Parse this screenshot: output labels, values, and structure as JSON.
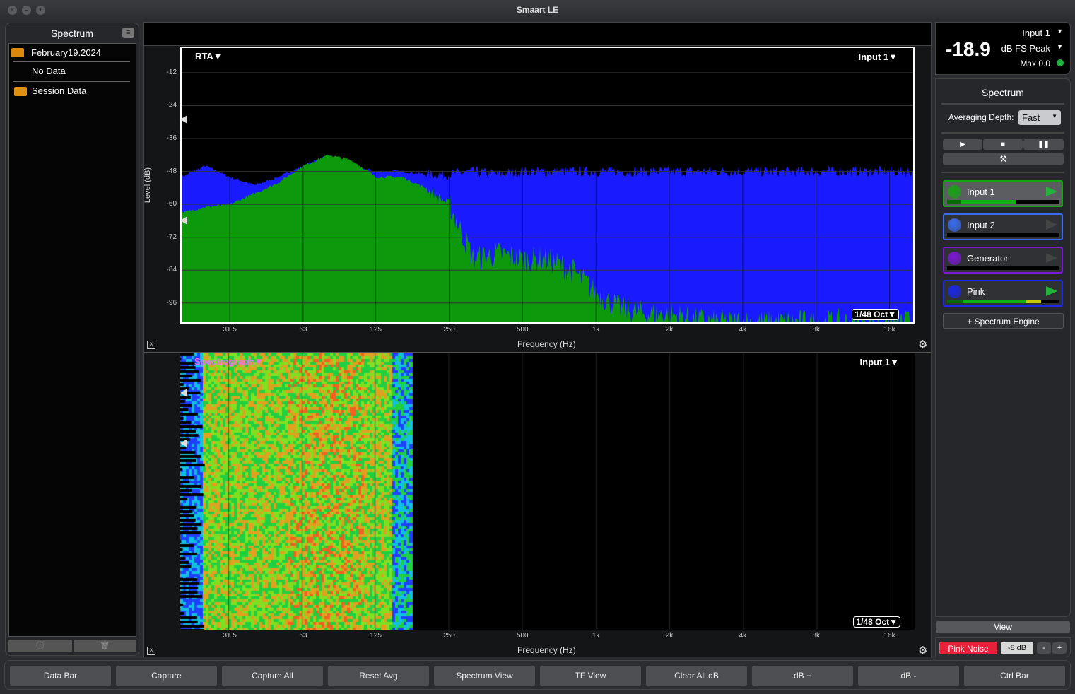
{
  "app": {
    "title": "Smaart LE"
  },
  "left": {
    "title": "Spectrum",
    "items": [
      {
        "label": "February19.2024",
        "type": "folder-open"
      },
      {
        "label": "No Data",
        "type": "item"
      },
      {
        "label": "Session Data",
        "type": "folder"
      }
    ]
  },
  "rta": {
    "mode_label": "RTA▼",
    "input_label": "Input 1▼",
    "resolution": "1/48 Oct▼",
    "ylabel": "Level (dB)",
    "xlabel": "Frequency (Hz)",
    "yticks": [
      "-12",
      "-24",
      "-36",
      "-48",
      "-60",
      "-72",
      "-84",
      "-96"
    ],
    "xticks": [
      "31.5",
      "63",
      "125",
      "250",
      "500",
      "1k",
      "2k",
      "4k",
      "8k",
      "16k"
    ]
  },
  "spectrograph": {
    "mode_label": "Spectrograph▼",
    "input_label": "Input 1▼",
    "resolution": "1/48 Oct▼",
    "xlabel": "Frequency (Hz)",
    "xticks": [
      "31.5",
      "63",
      "125",
      "250",
      "500",
      "1k",
      "2k",
      "4k",
      "8k",
      "16k"
    ]
  },
  "meter": {
    "value": "-18.9",
    "source": "Input 1",
    "unit": "dB FS Peak",
    "max": "Max 0.0",
    "status_color": "#1db33c"
  },
  "control": {
    "title": "Spectrum",
    "averaging_label": "Averaging Depth:",
    "averaging_value": "Fast",
    "engines": [
      {
        "name": "Input 1",
        "color": "#16a314",
        "active": true,
        "level": 0.62
      },
      {
        "name": "Input 2",
        "color": "#3a6cf0",
        "active": false,
        "level": 0
      },
      {
        "name": "Generator",
        "color": "#7d18d6",
        "active": false,
        "level": 0
      },
      {
        "name": "Pink",
        "color": "#1a28e8",
        "active": true,
        "level": 0.84
      }
    ],
    "add_engine": "+ Spectrum Engine",
    "view": "View",
    "pink_noise": "Pink Noise",
    "gen_level": "-8 dB",
    "minus": "-",
    "plus": "+"
  },
  "toolbar": [
    "Data Bar",
    "Capture",
    "Capture All",
    "Reset Avg",
    "Spectrum View",
    "TF View",
    "Clear All dB",
    "dB +",
    "dB -",
    "Ctrl Bar"
  ],
  "chart_data": {
    "type": "area",
    "xscale": "log",
    "xlim": [
      20,
      20000
    ],
    "ylim": [
      -103,
      -3
    ],
    "grid": true,
    "xlabel": "Frequency (Hz)",
    "ylabel": "Level (dB)",
    "x": [
      20,
      25,
      31.5,
      40,
      50,
      63,
      80,
      100,
      125,
      160,
      200,
      250,
      315,
      400,
      500,
      630,
      800,
      1000,
      1250,
      1600,
      2000,
      2500,
      3150,
      4000,
      5000,
      6300,
      8000,
      10000,
      12500,
      16000,
      20000
    ],
    "series": [
      {
        "engine": "Pink",
        "color": "#1a1aff",
        "values": [
          -50,
          -46,
          -50,
          -53,
          -50,
          -46,
          -42,
          -46,
          -48,
          -48,
          -49,
          -49,
          -48,
          -49,
          -48,
          -48,
          -48,
          -48,
          -48,
          -48,
          -48,
          -48,
          -48,
          -48,
          -48,
          -48,
          -48,
          -48,
          -48,
          -48,
          -48
        ]
      },
      {
        "engine": "Input 1",
        "color": "#0c9a0c",
        "values": [
          -63,
          -61,
          -60,
          -56,
          -52,
          -46,
          -42,
          -44,
          -50,
          -50,
          -54,
          -60,
          -80,
          -78,
          -80,
          -80,
          -84,
          -92,
          -98,
          -100,
          -100,
          -102,
          -103,
          -103,
          -103,
          -103,
          -103,
          -103,
          -103,
          -103,
          -103
        ]
      }
    ]
  }
}
